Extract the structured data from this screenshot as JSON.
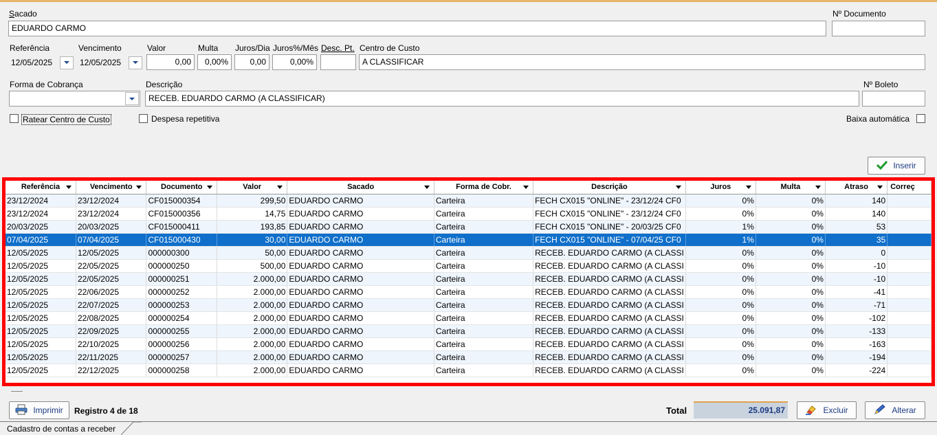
{
  "form": {
    "sacado_label": "Sacado",
    "sacado_value": "EDUARDO CARMO",
    "nro_documento_label": "Nº Documento",
    "nro_documento_value": "",
    "referencia_label": "Referência",
    "referencia_value": "12/05/2025",
    "vencimento_label": "Vencimento",
    "vencimento_value": "12/05/2025",
    "valor_label": "Valor",
    "valor_value": "0,00",
    "multa_label": "Multa",
    "multa_value": "0,00%",
    "juros_dia_label": "Juros/Dia",
    "juros_dia_value": "0,00",
    "juros_mes_label": "Juros%/Mês",
    "juros_mes_value": "0,00%",
    "desc_pt_label": "Desc. Pt.",
    "desc_pt_value": "",
    "centro_custo_label": "Centro de Custo",
    "centro_custo_value": "A CLASSIFICAR",
    "forma_cobranca_label": "Forma de Cobrança",
    "forma_cobranca_value": "",
    "descricao_label": "Descrição",
    "descricao_value": "RECEB. EDUARDO CARMO (A CLASSIFICAR)",
    "nro_boleto_label": "Nº Boleto",
    "nro_boleto_value": "",
    "ratear_label": "Ratear Centro de Custo",
    "despesa_label": "Despesa repetitiva",
    "baixa_label": "Baixa automática",
    "inserir_label": "Inserir"
  },
  "grid": {
    "columns": [
      "Referência",
      "Vencimento",
      "Documento",
      "Valor",
      "Sacado",
      "Forma de Cobr.",
      "Descrição",
      "Juros",
      "Multa",
      "Atraso",
      "Correç"
    ],
    "rows": [
      [
        "23/12/2024",
        "23/12/2024",
        "CF015000354",
        "299,50",
        "EDUARDO CARMO",
        "Carteira",
        "FECH CX015 \"ONLINE\" - 23/12/24 CF0",
        "0%",
        "0%",
        "140",
        ""
      ],
      [
        "23/12/2024",
        "23/12/2024",
        "CF015000356",
        "14,75",
        "EDUARDO CARMO",
        "Carteira",
        "FECH CX015 \"ONLINE\" - 23/12/24 CF0",
        "0%",
        "0%",
        "140",
        ""
      ],
      [
        "20/03/2025",
        "20/03/2025",
        "CF015000411",
        "193,85",
        "EDUARDO CARMO",
        "Carteira",
        "FECH CX015 \"ONLINE\" - 20/03/25 CF0",
        "1%",
        "0%",
        "53",
        ""
      ],
      [
        "07/04/2025",
        "07/04/2025",
        "CF015000430",
        "30,00",
        "EDUARDO CARMO",
        "Carteira",
        "FECH CX015 \"ONLINE\" - 07/04/25 CF0",
        "1%",
        "0%",
        "35",
        ""
      ],
      [
        "12/05/2025",
        "12/05/2025",
        "000000300",
        "50,00",
        "EDUARDO CARMO",
        "Carteira",
        "RECEB. EDUARDO CARMO (A CLASSI",
        "0%",
        "0%",
        "0",
        ""
      ],
      [
        "12/05/2025",
        "22/05/2025",
        "000000250",
        "500,00",
        "EDUARDO CARMO",
        "Carteira",
        "RECEB. EDUARDO CARMO (A CLASSI",
        "0%",
        "0%",
        "-10",
        ""
      ],
      [
        "12/05/2025",
        "22/05/2025",
        "000000251",
        "2.000,00",
        "EDUARDO CARMO",
        "Carteira",
        "RECEB. EDUARDO CARMO (A CLASSI",
        "0%",
        "0%",
        "-10",
        ""
      ],
      [
        "12/05/2025",
        "22/06/2025",
        "000000252",
        "2.000,00",
        "EDUARDO CARMO",
        "Carteira",
        "RECEB. EDUARDO CARMO (A CLASSI",
        "0%",
        "0%",
        "-41",
        ""
      ],
      [
        "12/05/2025",
        "22/07/2025",
        "000000253",
        "2.000,00",
        "EDUARDO CARMO",
        "Carteira",
        "RECEB. EDUARDO CARMO (A CLASSI",
        "0%",
        "0%",
        "-71",
        ""
      ],
      [
        "12/05/2025",
        "22/08/2025",
        "000000254",
        "2.000,00",
        "EDUARDO CARMO",
        "Carteira",
        "RECEB. EDUARDO CARMO (A CLASSI",
        "0%",
        "0%",
        "-102",
        ""
      ],
      [
        "12/05/2025",
        "22/09/2025",
        "000000255",
        "2.000,00",
        "EDUARDO CARMO",
        "Carteira",
        "RECEB. EDUARDO CARMO (A CLASSI",
        "0%",
        "0%",
        "-133",
        ""
      ],
      [
        "12/05/2025",
        "22/10/2025",
        "000000256",
        "2.000,00",
        "EDUARDO CARMO",
        "Carteira",
        "RECEB. EDUARDO CARMO (A CLASSI",
        "0%",
        "0%",
        "-163",
        ""
      ],
      [
        "12/05/2025",
        "22/11/2025",
        "000000257",
        "2.000,00",
        "EDUARDO CARMO",
        "Carteira",
        "RECEB. EDUARDO CARMO (A CLASSI",
        "0%",
        "0%",
        "-194",
        ""
      ],
      [
        "12/05/2025",
        "22/12/2025",
        "000000258",
        "2.000,00",
        "EDUARDO CARMO",
        "Carteira",
        "RECEB. EDUARDO CARMO (A CLASSI",
        "0%",
        "0%",
        "-224",
        ""
      ]
    ],
    "selected_row": 3,
    "highlight_color": "#ff0000",
    "selection_color": "#0f6fca"
  },
  "footer": {
    "imprimir_label": "Imprimir",
    "registro_text": "Registro 4 de 18",
    "total_label": "Total",
    "total_value": "25.091,87",
    "excluir_label": "Excluir",
    "alterar_label": "Alterar"
  },
  "status": {
    "tab_label": "Cadastro de contas a receber"
  },
  "icons": {
    "inserir": "checkmark-icon",
    "imprimir": "printer-icon",
    "excluir": "eraser-icon",
    "alterar": "pen-icon"
  }
}
